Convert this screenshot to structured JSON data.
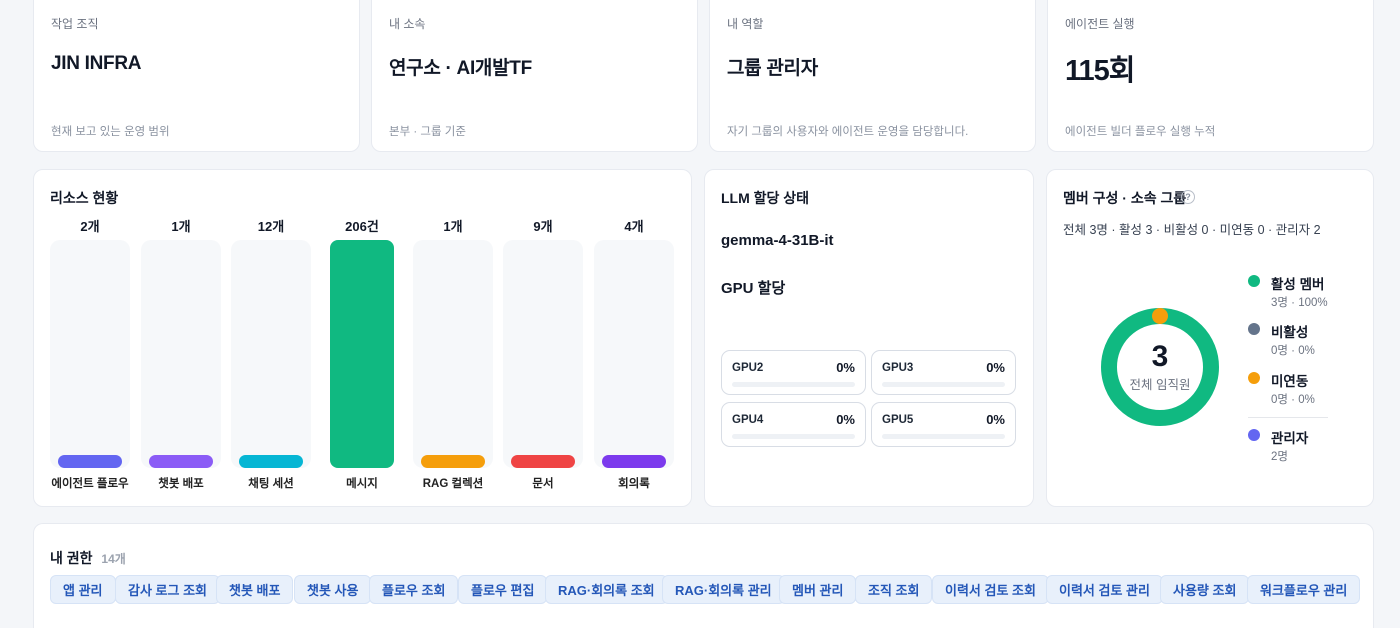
{
  "info_cards": [
    {
      "label": "작업 조직",
      "value": "JIN INFRA",
      "sub": "현재 보고 있는 운영 범위"
    },
    {
      "label": "내 소속",
      "value": "연구소 · AI개발TF",
      "sub": "본부 · 그룹 기준"
    },
    {
      "label": "내 역할",
      "value": "그룹 관리자",
      "sub": "자기 그룹의 사용자와 에이전트 운영을 담당합니다."
    },
    {
      "label": "에이전트 실행",
      "value": "115회",
      "sub": "에이전트 빌더 플로우 실행 누적"
    }
  ],
  "resources": {
    "title": "리소스 현황",
    "items": [
      {
        "count": "2개",
        "label": "에이전트 플로우",
        "color": "#6366f1"
      },
      {
        "count": "1개",
        "label": "챗봇 배포",
        "color": "#8b5cf6"
      },
      {
        "count": "12개",
        "label": "채팅 세션",
        "color": "#06b6d4"
      },
      {
        "count": "206건",
        "label": "메시지",
        "color": "#10b981"
      },
      {
        "count": "1개",
        "label": "RAG 컬렉션",
        "color": "#f59e0b"
      },
      {
        "count": "9개",
        "label": "문서",
        "color": "#ef4444"
      },
      {
        "count": "4개",
        "label": "회의록",
        "color": "#7c3aed"
      }
    ]
  },
  "chart_data": {
    "type": "bar",
    "categories": [
      "에이전트 플로우",
      "챗봇 배포",
      "채팅 세션",
      "메시지",
      "RAG 컬렉션",
      "문서",
      "회의록"
    ],
    "values": [
      2,
      1,
      12,
      206,
      1,
      9,
      4
    ]
  },
  "llm": {
    "title": "LLM 할당 상태",
    "model": "gemma-4-31B-it",
    "gpu_title": "GPU 할당",
    "gpus": [
      {
        "name": "GPU2",
        "pct": "0%",
        "usage": 0
      },
      {
        "name": "GPU3",
        "pct": "0%",
        "usage": 0
      },
      {
        "name": "GPU4",
        "pct": "0%",
        "usage": 0
      },
      {
        "name": "GPU5",
        "pct": "0%",
        "usage": 0
      }
    ]
  },
  "members": {
    "title": "멤버 구성 · 소속 그룹",
    "help_icon": "question-circle-icon",
    "summary": "전체 3명 · 활성 3 · 비활성 0 · 미연동 0 · 관리자 2",
    "total": "3",
    "total_label": "전체 임직원",
    "legend": [
      {
        "name": "활성 멤버",
        "sub": "3명 · 100%",
        "color": "#10b981"
      },
      {
        "name": "비활성",
        "sub": "0명 · 0%",
        "color": "#64748b"
      },
      {
        "name": "미연동",
        "sub": "0명 · 0%",
        "color": "#f59e0b"
      },
      {
        "name": "관리자",
        "sub": "2명",
        "color": "#6366f1"
      }
    ]
  },
  "permissions": {
    "title": "내 권한",
    "count": "14개",
    "items": [
      "앱 관리",
      "감사 로그 조회",
      "챗봇 배포",
      "챗봇 사용",
      "플로우 조회",
      "플로우 편집",
      "RAG·회의록 조회",
      "RAG·회의록 관리",
      "멤버 관리",
      "조직 조회",
      "이력서 검토 조회",
      "이력서 검토 관리",
      "사용량 조회",
      "워크플로우 관리"
    ]
  }
}
